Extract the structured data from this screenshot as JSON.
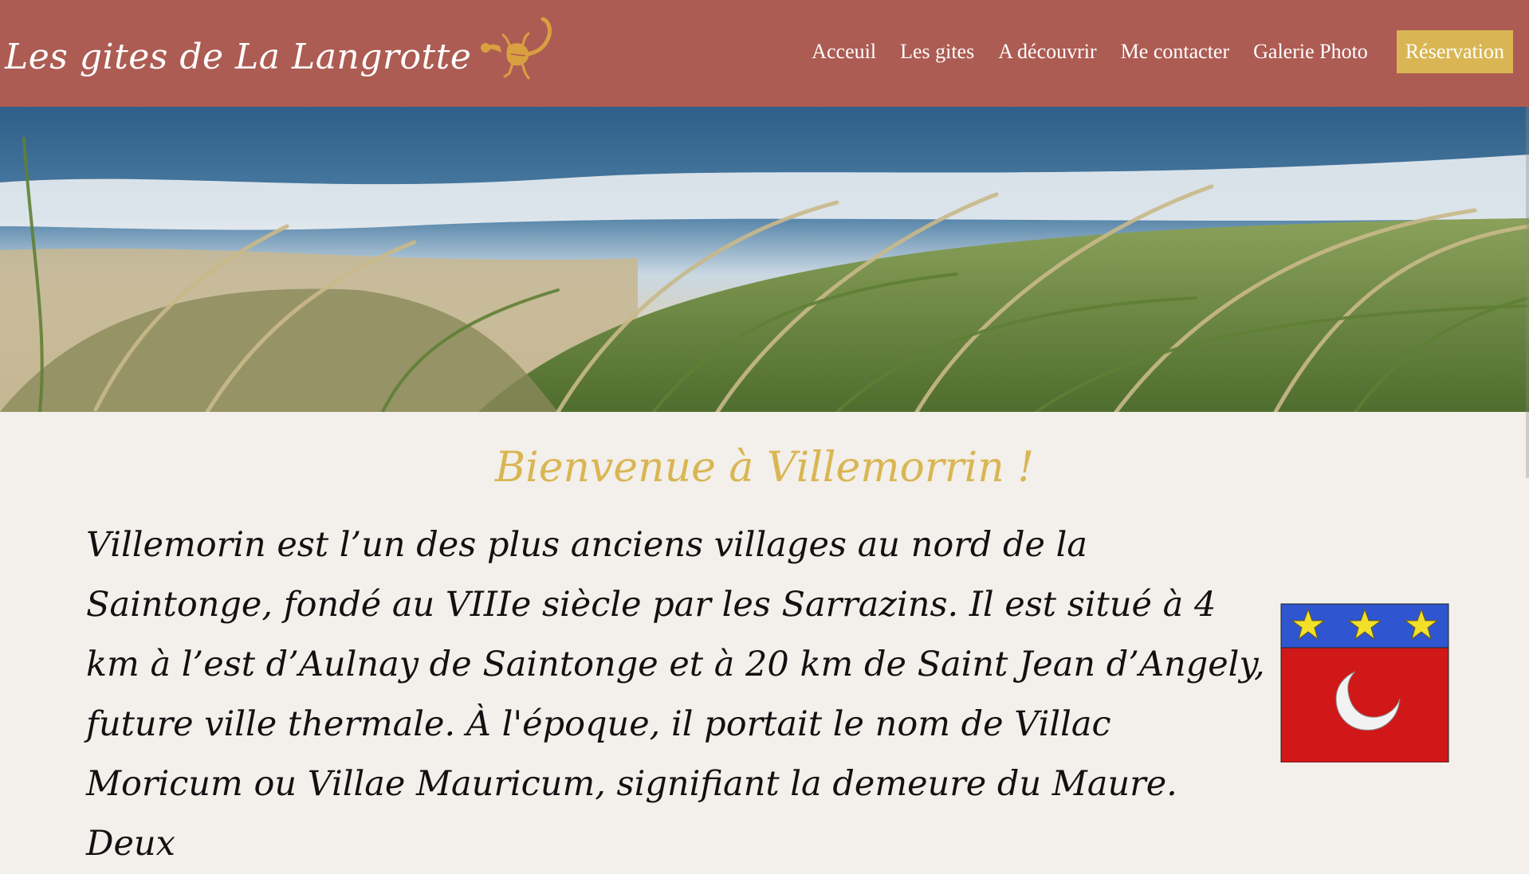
{
  "header": {
    "brand_title": "Les gites de La Langrotte",
    "logo_icon": "gecko-icon",
    "background_color": "#ad5c53"
  },
  "nav": {
    "items": [
      {
        "label": "Acceuil"
      },
      {
        "label": "Les gites"
      },
      {
        "label": "A découvrir"
      },
      {
        "label": "Me contacter"
      },
      {
        "label": "Galerie Photo"
      }
    ],
    "cta_label": "Réservation",
    "cta_color": "#d9b653"
  },
  "hero": {
    "image": "beach-dune-grass-photo"
  },
  "main": {
    "heading": "Bienvenue à Villemorrin !",
    "heading_color": "#d9b653",
    "paragraph": "Villemorin est l’un des plus anciens villages au nord de la Saintonge, fondé au VIIIe siècle par les Sarrazins. Il est situé à 4 km à l’est d’Aulnay de Saintonge et à 20 km de Saint Jean d’Angely, future ville thermale. À l'époque, il portait le nom de Villac Moricum ou Villae Mauricum, signifiant la demeure du Maure. Deux",
    "crest_image": "coat-of-arms-crescent-stars"
  }
}
